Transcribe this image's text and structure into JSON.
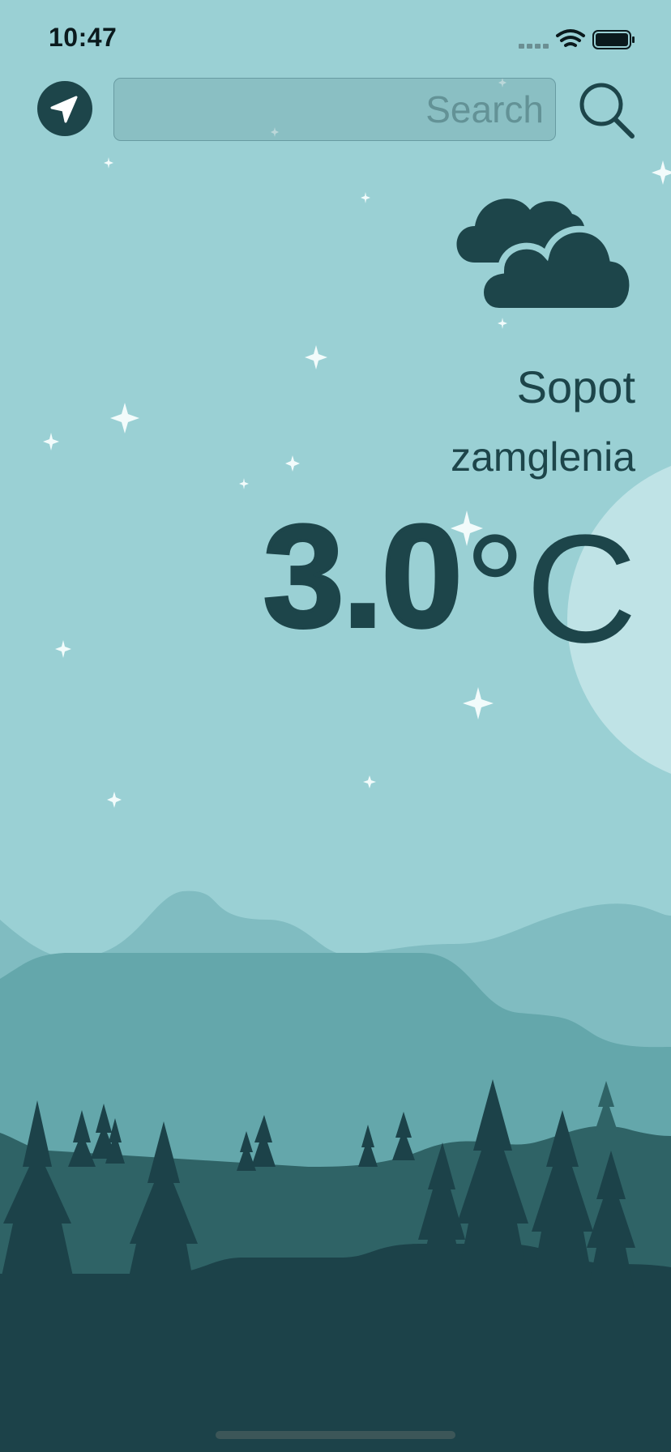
{
  "status_bar": {
    "time": "10:47"
  },
  "search": {
    "placeholder": "Search",
    "value": ""
  },
  "weather": {
    "city": "Sopot",
    "condition": "zamglenia",
    "temperature": "3.0",
    "unit": "°C",
    "icon": "cloudy-icon"
  },
  "colors": {
    "sky": "#9ad0d4",
    "accent": "#1d454a",
    "moon": "#bfe3e6",
    "hill_far": "#80bcc1",
    "hill_mid": "#64a7ab",
    "hill_near": "#2f6366",
    "ground": "#1c4249"
  }
}
